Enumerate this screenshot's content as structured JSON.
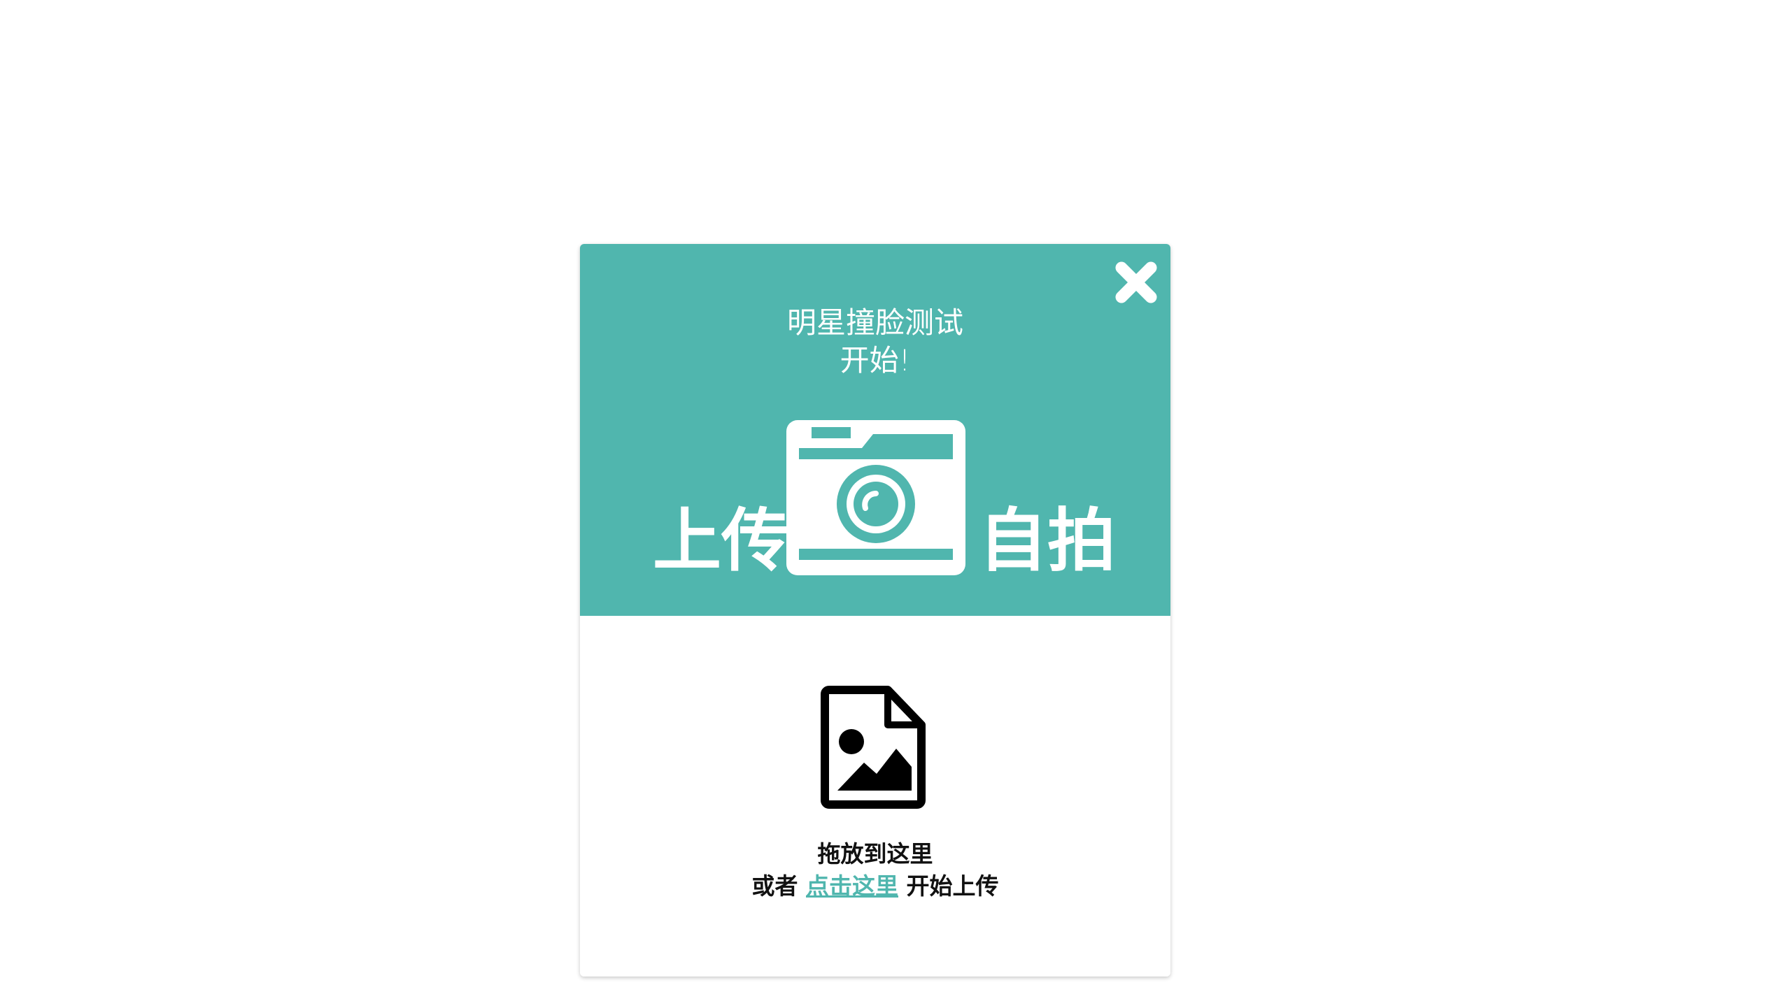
{
  "colors": {
    "accent": "#50b6ae",
    "header_text": "#ffffff",
    "body_text": "#111111"
  },
  "dialog": {
    "close_icon": "close-x-icon",
    "title_line1": "明星撞脸测试",
    "title_line2": "开始!",
    "upload_left": "上传",
    "upload_right": "自拍",
    "camera_icon": "camera-icon"
  },
  "dropzone": {
    "file_icon": "image-file-icon",
    "drop_text": "拖放到这里",
    "or_text": "或者",
    "click_link": "点击这里",
    "start_upload": "开始上传"
  }
}
